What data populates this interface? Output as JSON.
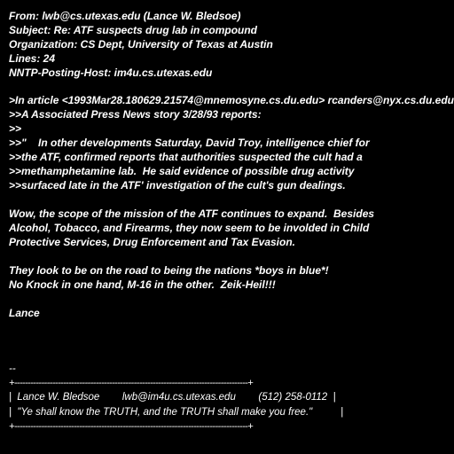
{
  "header": {
    "from": "From: lwb@cs.utexas.edu (Lance W. Bledsoe)",
    "subject": "Subject: Re: ATF suspects drug lab in compound",
    "organization": "Organization: CS Dept, University of Texas at Austin",
    "lines": "Lines: 24",
    "posting_host": "NNTP-Posting-Host: im4u.cs.utexas.edu"
  },
  "quoted": [
    ">In article <1993Mar28.180629.21574@mnemosyne.cs.du.edu> rcanders@nyx.cs.du.edu",
    ">>A Associated Press News story 3/28/93 reports:",
    ">>",
    ">>\"    In other developments Saturday, David Troy, intelligence chief for",
    ">>the ATF, confirmed reports that authorities suspected the cult had a",
    ">>methamphetamine lab.  He said evidence of possible drug activity",
    ">>surfaced late in the ATF' investigation of the cult's gun dealings."
  ],
  "body": {
    "paragraph1": [
      "Wow, the scope of the mission of the ATF continues to expand.  Besides",
      "Alcohol, Tobacco, and Firearms, they now seem to be involded in Child",
      "Protective Services, Drug Enforcement and Tax Evasion."
    ],
    "paragraph2": [
      "They look to be on the road to being the nations *boys in blue*!",
      "No Knock in one hand, M-16 in the other.  Zeik-Heil!!!"
    ],
    "closing": "Lance"
  },
  "signature": {
    "dashes": "--",
    "border_top": "+--------------------------------------------------------------------------------------+",
    "line1": "|  Lance W. Bledsoe        lwb@im4u.cs.utexas.edu        (512) 258-0112  |",
    "line2": "|  \"Ye shall know the TRUTH, and the TRUTH shall make you free.\"          |",
    "border_bottom": "+--------------------------------------------------------------------------------------+"
  },
  "colors": {
    "background": "#000000",
    "text": "#ffffff"
  }
}
